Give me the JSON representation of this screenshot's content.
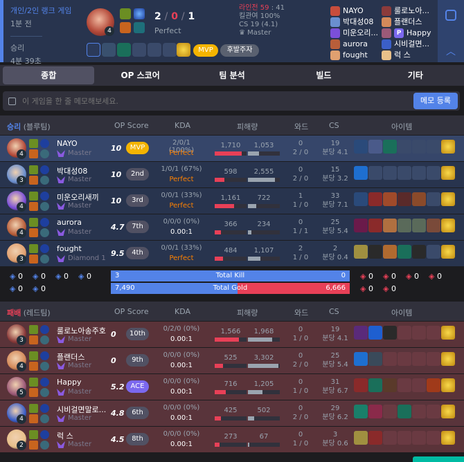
{
  "summary": {
    "queue": "개인/2인 랭크 게임",
    "ago": "1분 전",
    "result": "승리",
    "length": "4분 39초",
    "champ_level": "4",
    "kda": {
      "k": "2",
      "d": "0",
      "a": "1",
      "sep": "/"
    },
    "kda_grade": "Perfect",
    "lp": "라인전 59",
    "lp_val": ": 41",
    "kill_part": "킬관여 100%",
    "cs": "CS 19 (4.1)",
    "tier": "Master",
    "mvp": "MVP",
    "badge": "후발주자",
    "players": [
      {
        "name": "NAYO",
        "color": "#c84d3c"
      },
      {
        "name": "박대성08",
        "color": "#6a8fcf"
      },
      {
        "name": "미운오리...",
        "color": "#7b4fd8"
      },
      {
        "name": "aurora",
        "color": "#b85e3a"
      },
      {
        "name": "fought",
        "color": "#e0a070"
      },
      {
        "name": "룰로노아...",
        "color": "#8b3b3b"
      },
      {
        "name": "플랜더스",
        "color": "#d48a5a"
      },
      {
        "name": "Happy",
        "color": "#9c5a78",
        "prefix": "P"
      },
      {
        "name": "시비걸면...",
        "color": "#3b5fc8"
      },
      {
        "name": "럭 스",
        "color": "#e8c08a"
      }
    ]
  },
  "tabs": [
    "종합",
    "OP 스코어",
    "팀 분석",
    "빌드",
    "기타"
  ],
  "memo": {
    "placeholder": "이 게임을 한 줄 메모해보세요.",
    "button": "메모 등록"
  },
  "headers": {
    "op": "OP Score",
    "kda": "KDA",
    "dmg": "피해량",
    "ward": "와드",
    "cs": "CS",
    "item": "아이템"
  },
  "blue": {
    "title": "승리",
    "side": "(블루팀)",
    "players": [
      {
        "name": "NAYO",
        "tier": "Master",
        "op": "10",
        "rank": "MVP",
        "kda": "2/0/1 (100%)",
        "ratio": "Perfect",
        "dmg": "1,710",
        "taken": "1,053",
        "ward1": "0",
        "ward2": "2 / 0",
        "cs": "19",
        "csm": "분당 4.1",
        "lvl": "4",
        "dmg_frac": 0.85,
        "taken_frac": 0.35,
        "color": "#b44a3a"
      },
      {
        "name": "박대성08",
        "tier": "Master",
        "op": "10",
        "rank": "2nd",
        "kda": "1/0/1 (67%)",
        "ratio": "Perfect",
        "dmg": "598",
        "taken": "2,555",
        "ward1": "0",
        "ward2": "2 / 0",
        "cs": "15",
        "csm": "분당 3.2",
        "lvl": "3",
        "dmg_frac": 0.3,
        "taken_frac": 0.85,
        "color": "#6a8fcf"
      },
      {
        "name": "미운오리새끼",
        "tier": "Master",
        "op": "10",
        "rank": "3rd",
        "kda": "0/0/1 (33%)",
        "ratio": "Perfect",
        "dmg": "1,161",
        "taken": "722",
        "ward1": "1",
        "ward2": "1 / 0",
        "cs": "33",
        "csm": "분당 7.1",
        "lvl": "4",
        "dmg_frac": 0.6,
        "taken_frac": 0.25,
        "color": "#7b4fd8"
      },
      {
        "name": "aurora",
        "tier": "Master",
        "op": "4.7",
        "rank": "7th",
        "kda": "0/0/0 (0%)",
        "ratio": "0.00:1",
        "dmg": "366",
        "taken": "234",
        "ward1": "0",
        "ward2": "1 / 1",
        "cs": "25",
        "csm": "분당 5.4",
        "lvl": "4",
        "dmg_frac": 0.2,
        "taken_frac": 0.1,
        "color": "#b85e3a"
      },
      {
        "name": "fought",
        "tier": "Diamond 1",
        "op": "9.5",
        "rank": "4th",
        "kda": "0/0/1 (33%)",
        "ratio": "Perfect",
        "dmg": "484",
        "taken": "1,107",
        "ward1": "2",
        "ward2": "1 / 0",
        "cs": "2",
        "csm": "분당 0.4",
        "lvl": "3",
        "dmg_frac": 0.25,
        "taken_frac": 0.4,
        "color": "#e0a070"
      }
    ]
  },
  "totals": {
    "kill_label": "Total Kill",
    "gold_label": "Total Gold",
    "blue_kill": "3",
    "red_kill": "0",
    "blue_gold": "7,490",
    "red_gold": "6,666",
    "kill_frac": 1.0,
    "gold_frac": 0.53,
    "blue_obj": [
      "0",
      "0",
      "0",
      "0",
      "0",
      "0"
    ],
    "red_obj": [
      "0",
      "0",
      "0",
      "0",
      "0",
      "0"
    ]
  },
  "red": {
    "title": "패배",
    "side": "(레드팀)",
    "players": [
      {
        "name": "룰로노아송주호",
        "tier": "Master",
        "op": "0",
        "rank": "10th",
        "kda": "0/2/0 (0%)",
        "ratio": "0.00:1",
        "dmg": "1,566",
        "taken": "1,968",
        "ward1": "0",
        "ward2": "1 / 0",
        "cs": "19",
        "csm": "분당 4.1",
        "lvl": "3",
        "dmg_frac": 0.75,
        "taken_frac": 0.75,
        "color": "#8b3b3b"
      },
      {
        "name": "플랜더스",
        "tier": "Master",
        "op": "0",
        "rank": "9th",
        "kda": "0/0/0 (0%)",
        "ratio": "0.00:1",
        "dmg": "525",
        "taken": "3,302",
        "ward1": "0",
        "ward2": "2 / 0",
        "cs": "25",
        "csm": "분당 5.4",
        "lvl": "4",
        "dmg_frac": 0.25,
        "taken_frac": 0.95,
        "color": "#d48a5a"
      },
      {
        "name": "Happy",
        "tier": "Master",
        "op": "5.2",
        "rank": "ACE",
        "kda": "0/0/0 (0%)",
        "ratio": "0.00:1",
        "dmg": "716",
        "taken": "1,205",
        "ward1": "0",
        "ward2": "1 / 0",
        "cs": "31",
        "csm": "분당 6.7",
        "lvl": "5",
        "dmg_frac": 0.35,
        "taken_frac": 0.45,
        "color": "#9c5a78"
      },
      {
        "name": "시비걸면말로...",
        "tier": "Master",
        "op": "4.8",
        "rank": "6th",
        "kda": "0/0/0 (0%)",
        "ratio": "0.00:1",
        "dmg": "425",
        "taken": "502",
        "ward1": "0",
        "ward2": "2 / 0",
        "cs": "29",
        "csm": "분당 6.2",
        "lvl": "4",
        "dmg_frac": 0.2,
        "taken_frac": 0.2,
        "color": "#3b5fc8"
      },
      {
        "name": "럭 스",
        "tier": "Master",
        "op": "4.5",
        "rank": "8th",
        "kda": "0/0/0 (0%)",
        "ratio": "0.00:1",
        "dmg": "273",
        "taken": "67",
        "ward1": "0",
        "ward2": "1 / 0",
        "cs": "3",
        "csm": "분당 0.6",
        "lvl": "2",
        "dmg_frac": 0.15,
        "taken_frac": 0.05,
        "color": "#e8c08a"
      }
    ]
  },
  "colors": {
    "blue": "#5383e8",
    "red": "#e84057",
    "gold": "#f4b400"
  }
}
